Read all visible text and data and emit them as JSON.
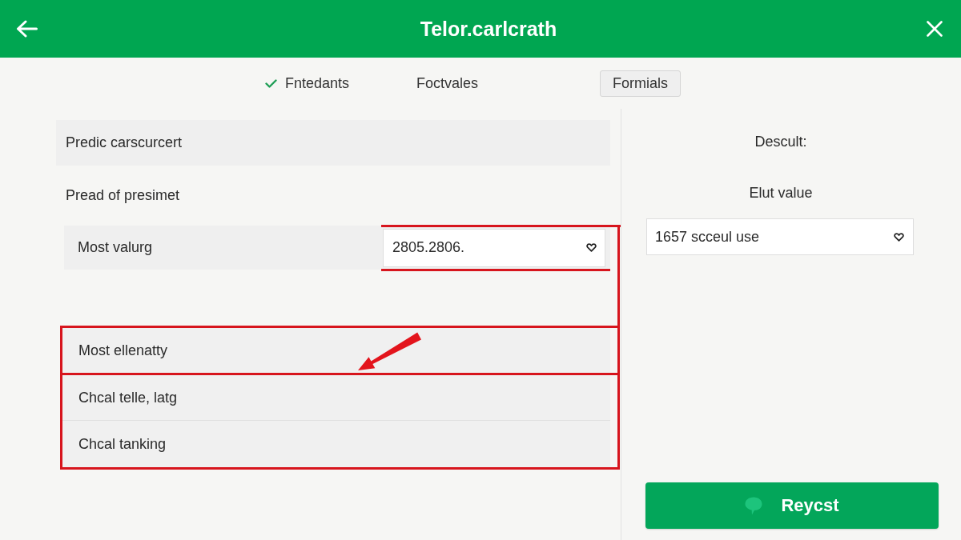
{
  "header": {
    "title": "Telor.carlcrath"
  },
  "tabs": [
    {
      "label": "Fntedants",
      "selected": false,
      "checked": true
    },
    {
      "label": "Foctvales",
      "selected": false,
      "checked": false
    },
    {
      "label": "Formials",
      "selected": true,
      "checked": false
    }
  ],
  "form": {
    "rows": [
      {
        "kind": "panel",
        "label": "Predic carscurcert"
      },
      {
        "kind": "heading",
        "label": "Pread of presimet"
      },
      {
        "kind": "select",
        "label": "Most valurg",
        "value": "2805.2806."
      }
    ],
    "highlight_groups": [
      {
        "items": [
          "Most ellenatty"
        ]
      },
      {
        "items": [
          "Chcal telle, latg",
          "Chcal tanking"
        ]
      }
    ]
  },
  "side": {
    "title": "Descult:",
    "field_label": "Elut value",
    "select_value": "1657 scceul use",
    "button": "Reycst"
  }
}
